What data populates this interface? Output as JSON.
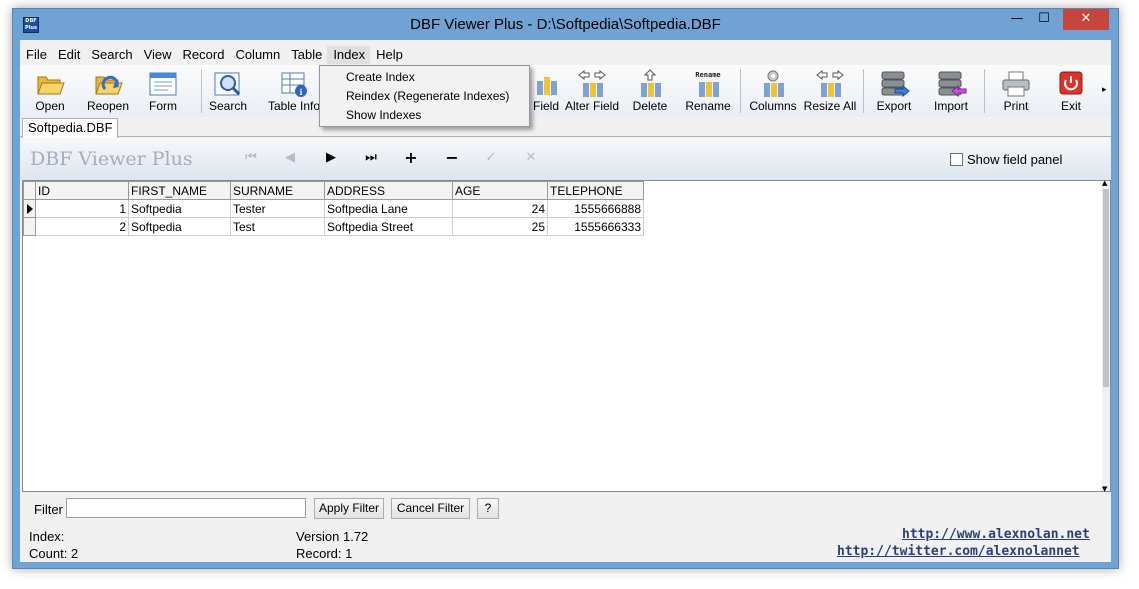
{
  "window": {
    "title": "DBF Viewer Plus - D:\\Softpedia\\Softpedia.DBF",
    "icon_text": "DBF Plus",
    "minimize_glyph": "—",
    "maximize_glyph": "☐",
    "close_glyph": "✕"
  },
  "menubar": {
    "items": [
      "File",
      "Edit",
      "Search",
      "View",
      "Record",
      "Column",
      "Table",
      "Index",
      "Help"
    ],
    "active": "Index"
  },
  "index_menu": {
    "items": [
      "Create Index",
      "Reindex (Regenerate Indexes)",
      "Show Indexes"
    ]
  },
  "toolbar": {
    "buttons": [
      {
        "label": "Open",
        "icon": "folder-icon"
      },
      {
        "label": "Reopen",
        "icon": "reopen-icon"
      },
      {
        "label": "Form",
        "icon": "form-icon"
      },
      {
        "label": "Search",
        "icon": "search-icon"
      },
      {
        "label": "Table Info",
        "icon": "table-info-icon"
      },
      {
        "label": "Field",
        "icon": "add-field-icon"
      },
      {
        "label": "Alter Field",
        "icon": "alter-field-icon"
      },
      {
        "label": "Delete",
        "icon": "delete-field-icon"
      },
      {
        "label": "Rename",
        "icon": "rename-icon"
      },
      {
        "label": "Columns",
        "icon": "columns-icon"
      },
      {
        "label": "Resize All",
        "icon": "resize-all-icon"
      },
      {
        "label": "Export",
        "icon": "export-icon"
      },
      {
        "label": "Import",
        "icon": "import-icon"
      },
      {
        "label": "Print",
        "icon": "printer-icon"
      },
      {
        "label": "Exit",
        "icon": "exit-icon"
      }
    ],
    "rename_icon_text": "Rename",
    "more_glyph": "▸"
  },
  "tabs": [
    "Softpedia.DBF"
  ],
  "navbar": {
    "brand": "DBF Viewer Plus",
    "glyphs": {
      "first": "⏮",
      "prev": "◀",
      "next": "▶",
      "last": "⏭",
      "add": "+",
      "remove": "−",
      "confirm": "✓",
      "cancel": "✕"
    },
    "show_field_panel": "Show field panel"
  },
  "grid": {
    "columns": [
      "ID",
      "FIRST_NAME",
      "SURNAME",
      "ADDRESS",
      "AGE",
      "TELEPHONE"
    ],
    "rows": [
      [
        "1",
        "Softpedia",
        "Tester",
        "Softpedia Lane",
        "24",
        "1555666888"
      ],
      [
        "2",
        "Softpedia",
        "Test",
        "Softpedia Street",
        "25",
        "1555666333"
      ]
    ],
    "scroll_up_glyph": "▲",
    "scroll_down_glyph": "▼"
  },
  "filter": {
    "label": "Filter",
    "value": "",
    "apply_label": "Apply Filter",
    "cancel_label": "Cancel Filter",
    "help_label": "?"
  },
  "status": {
    "index_label": "Index:",
    "count_label": "Count: 2",
    "version": "Version 1.72",
    "record": "Record: 1",
    "link1": "http://www.alexnolan.net",
    "link2": "http://twitter.com/alexnolannet"
  },
  "colors": {
    "window_frame": "#71a2d4",
    "close_button": "#c7453c",
    "link": "#2b3f7c"
  }
}
